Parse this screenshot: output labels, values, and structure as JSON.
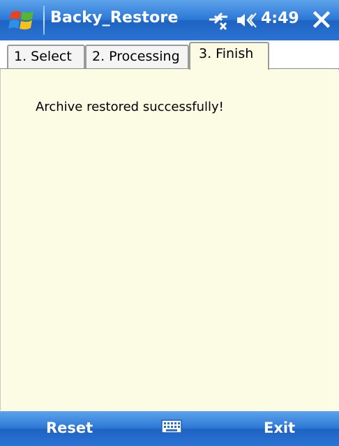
{
  "titlebar": {
    "app_title": "Backy_Restore",
    "time": "4:49",
    "start_icon": "windows-start-icon",
    "connectivity_icon": "connectivity-icon",
    "volume_icon": "volume-icon",
    "close_icon": "close-icon"
  },
  "tabs": [
    {
      "label": "1. Select",
      "active": false
    },
    {
      "label": "2. Processing",
      "active": false
    },
    {
      "label": "3. Finish",
      "active": true
    }
  ],
  "content": {
    "message": "Archive restored successfully!"
  },
  "softkeys": {
    "left": "Reset",
    "right": "Exit",
    "keyboard_icon": "keyboard-icon"
  },
  "colors": {
    "bar_blue": "#2c78d6",
    "content_bg": "#fcfbe3"
  }
}
